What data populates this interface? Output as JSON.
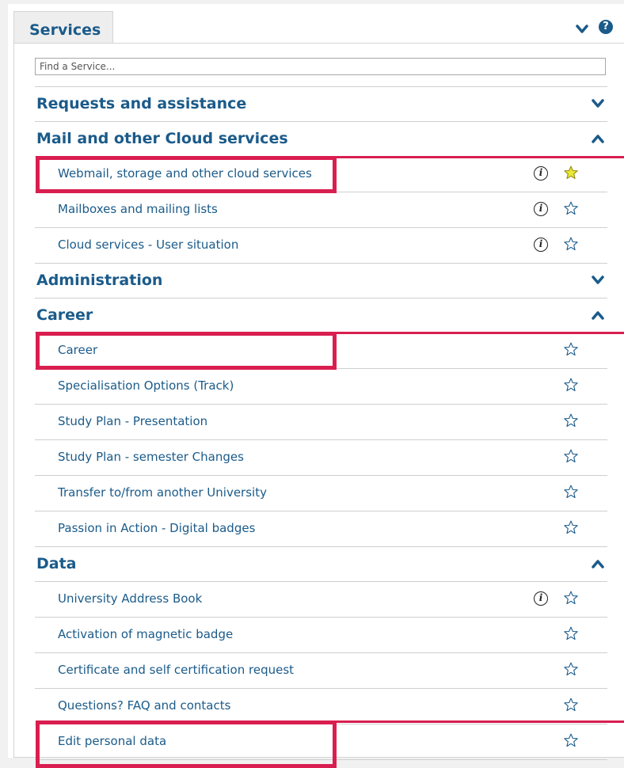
{
  "panel": {
    "tab_label": "Services",
    "help_label": "?",
    "search": {
      "placeholder": "Find a Service...",
      "value": ""
    }
  },
  "colors": {
    "accent": "#1b5b8a",
    "highlight": "#d91e50",
    "favorite_star": "#e9ea33"
  },
  "categories": [
    {
      "label": "Requests and assistance",
      "expanded": false
    },
    {
      "label": "Mail and other Cloud services",
      "expanded": true,
      "items": [
        {
          "label": "Webmail, storage and other cloud services",
          "info": true,
          "favorite": true
        },
        {
          "label": "Mailboxes and mailing lists",
          "info": true,
          "favorite": false
        },
        {
          "label": "Cloud services - User situation",
          "info": true,
          "favorite": false
        }
      ]
    },
    {
      "label": "Administration",
      "expanded": false
    },
    {
      "label": "Career",
      "expanded": true,
      "items": [
        {
          "label": "Career",
          "info": false,
          "favorite": false
        },
        {
          "label": "Specialisation Options (Track)",
          "info": false,
          "favorite": false
        },
        {
          "label": "Study Plan - Presentation",
          "info": false,
          "favorite": false
        },
        {
          "label": "Study Plan - semester Changes",
          "info": false,
          "favorite": false
        },
        {
          "label": "Transfer to/from another University",
          "info": false,
          "favorite": false
        },
        {
          "label": "Passion in Action - Digital badges",
          "info": false,
          "favorite": false
        }
      ]
    },
    {
      "label": "Data",
      "expanded": true,
      "items": [
        {
          "label": "University Address Book",
          "info": true,
          "favorite": false
        },
        {
          "label": "Activation of magnetic badge",
          "info": false,
          "favorite": false
        },
        {
          "label": "Certificate and self certification request",
          "info": false,
          "favorite": false
        },
        {
          "label": "Questions? FAQ and contacts",
          "info": false,
          "favorite": false
        },
        {
          "label": "Edit personal data",
          "info": false,
          "favorite": false
        }
      ]
    }
  ]
}
